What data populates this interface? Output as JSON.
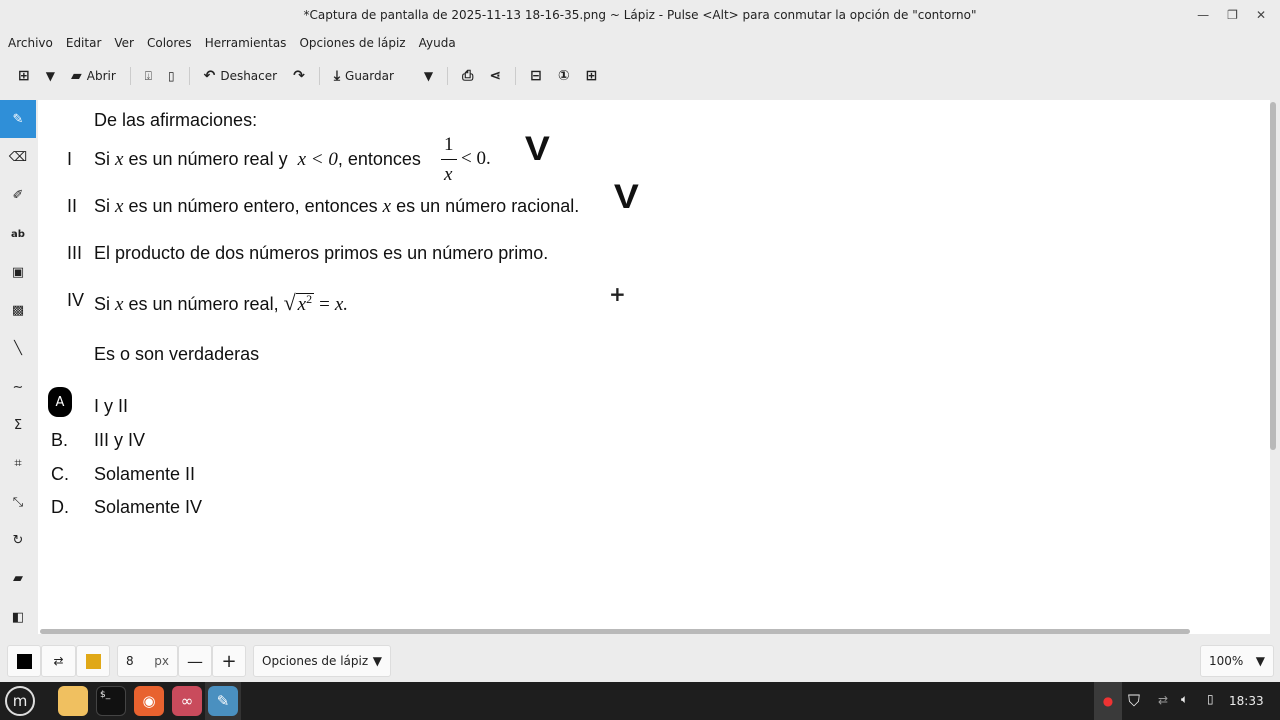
{
  "window": {
    "title": "*Captura de pantalla de 2025-11-13 18-16-35.png ~ Lápiz - Pulse <Alt> para conmutar la opción de \"contorno\""
  },
  "menu": [
    "Archivo",
    "Editar",
    "Ver",
    "Colores",
    "Herramientas",
    "Opciones de lápiz",
    "Ayuda"
  ],
  "toolbar": {
    "open": "Abrir",
    "undo": "Deshacer",
    "save": "Guardar"
  },
  "content": {
    "intro": "De las afirmaciones:",
    "items": [
      {
        "num": "I",
        "a": "Si",
        "x": "x",
        "b": "es un número real y",
        "cond": "x < 0",
        "c": ", entonces",
        "frac_num": "1",
        "frac_den": "x",
        "d": "< 0."
      },
      {
        "num": "II",
        "a": "Si",
        "x": "x",
        "b": "es un número entero, entonces",
        "x2": "x",
        "c": "es un número racional."
      },
      {
        "num": "III",
        "text": "El producto de dos números primos es un número primo."
      },
      {
        "num": "IV",
        "a": "Si",
        "x": "x",
        "b": "es un número real,",
        "sq": "x",
        "exp": "2",
        "eq": "=",
        "rhs": "x."
      }
    ],
    "question": "Es o son verdaderas",
    "options": [
      {
        "l": "A",
        "t": "I y II"
      },
      {
        "l": "B.",
        "t": "III y IV"
      },
      {
        "l": "C.",
        "t": "Solamente II"
      },
      {
        "l": "D.",
        "t": "Solamente IV"
      }
    ],
    "marks": [
      "V",
      "V"
    ]
  },
  "bottom": {
    "size": "8",
    "unit": "px",
    "options": "Opciones de lápiz",
    "zoom": "100%",
    "primary_color": "#000000",
    "secondary_color": "#e0a817"
  },
  "taskbar": {
    "clock": "18:33"
  }
}
